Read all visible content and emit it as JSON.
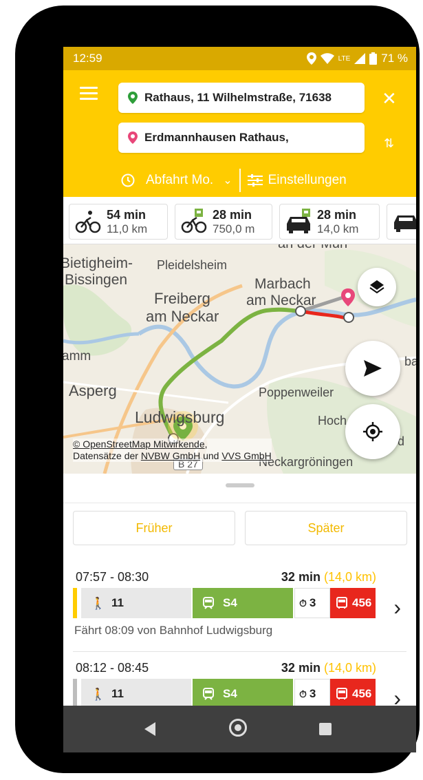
{
  "status": {
    "time": "12:59",
    "network": "LTE",
    "battery": "71 %"
  },
  "header": {
    "from": "Rathaus, 11 Wilhelmstraße, 71638",
    "to": "Erdmannhausen Rathaus,",
    "departure": "Abfahrt Mo.",
    "settings": "Einstellungen"
  },
  "modes": [
    {
      "icon": "bicycle-icon",
      "duration": "54 min",
      "distance": "11,0 km"
    },
    {
      "icon": "bike-and-ride-icon",
      "duration": "28 min",
      "distance": "750,0 m"
    },
    {
      "icon": "park-and-ride-icon",
      "duration": "28 min",
      "distance": "14,0 km"
    },
    {
      "icon": "car-icon",
      "duration": "",
      "distance": ""
    }
  ],
  "map": {
    "labels": {
      "bietigheim1": "Bietigheim-",
      "bissingen": "Bissingen",
      "pleidelsheim": "Pleidelsheim",
      "marbach": "Marbach",
      "amneckar_marbach": "am Neckar",
      "freiberg": "Freiberg",
      "amneckar": "am Neckar",
      "amm": "amm",
      "asperg": "Asperg",
      "poppenweiler": "Poppenweiler",
      "ludwigsburg": "Ludwigsburg",
      "hoch": "Hoch",
      "bac": "bac",
      "d": "d",
      "b27": "B 27",
      "neckargroningen": "Neckargröningen",
      "anderMurr": "an der Murr"
    },
    "attribution_line1": "© OpenStreetMap Mitwirkende,",
    "attribution_line2_prefix": "Datensätze der ",
    "attribution_link1": "NVBW GmbH",
    "attribution_mid": " und ",
    "attribution_link2": "VVS GmbH",
    "route_colors": {
      "train": "#7cb342",
      "bus": "#e8271d",
      "walk": "#9e9e9e"
    }
  },
  "sheet": {
    "earlier": "Früher",
    "later": "Später"
  },
  "trips": [
    {
      "time": "07:57 - 08:30",
      "duration": "32 min",
      "distance": "(14,0 km)",
      "walk": "11",
      "train": "S4",
      "transfer": "3",
      "bus": "456",
      "info": "Fährt 08:09 von Bahnhof Ludwigsburg",
      "accent": "#ffcc00"
    },
    {
      "time": "08:12 - 08:45",
      "duration": "32 min",
      "distance": "(14,0 km)",
      "walk": "11",
      "train": "S4",
      "transfer": "3",
      "bus": "456",
      "info": "",
      "accent": "#bdbdbd"
    }
  ],
  "colors": {
    "brand": "#ffcc00",
    "accent_text": "#f2b900",
    "pin_start": "#2e9e3a",
    "pin_end": "#e8477a"
  }
}
